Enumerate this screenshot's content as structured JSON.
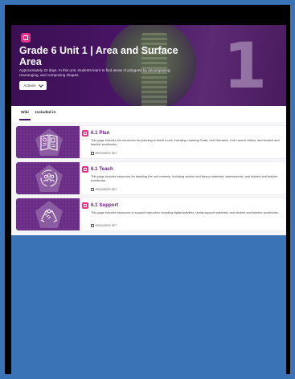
{
  "hero": {
    "title": "Grade 6 Unit 1 | Area and Surface Area",
    "description": "Approximately 22 days. In this unit, students learn to find areas of polygons by decomposing, rearranging, and composing shapes.",
    "big_number": "1",
    "actions_label": "Actions"
  },
  "tabs": [
    {
      "label": "Wiki",
      "active": true
    },
    {
      "label": "Included in",
      "active": false
    }
  ],
  "items": [
    {
      "title": "6.1 Plan",
      "description": "This page includes the resources for planning to teach a unit, including Learning Goals, Unit Narrative, Unit Launch videos, and student and teacher workbooks.",
      "meta": "RESOURCE SET",
      "thumb_icon": "book-icon"
    },
    {
      "title": "6.1 Teach",
      "description": "This page includes resources for teaching the unit contents, including section and lesson materials, assessments, and student and teacher workbooks.",
      "meta": "RESOURCE SET",
      "thumb_icon": "people-cycle-icon"
    },
    {
      "title": "6.1 Support",
      "description": "This page includes resources to support instruction including digital activities, family support materials, and student and teacher workbooks.",
      "meta": "RESOURCE SET",
      "thumb_icon": "handshake-icon"
    }
  ],
  "colors": {
    "background": "#3a74b6",
    "hero": "#4a1667",
    "accent": "#e0338d",
    "title": "#6a1b7d",
    "thumb": "#6a2d86"
  }
}
